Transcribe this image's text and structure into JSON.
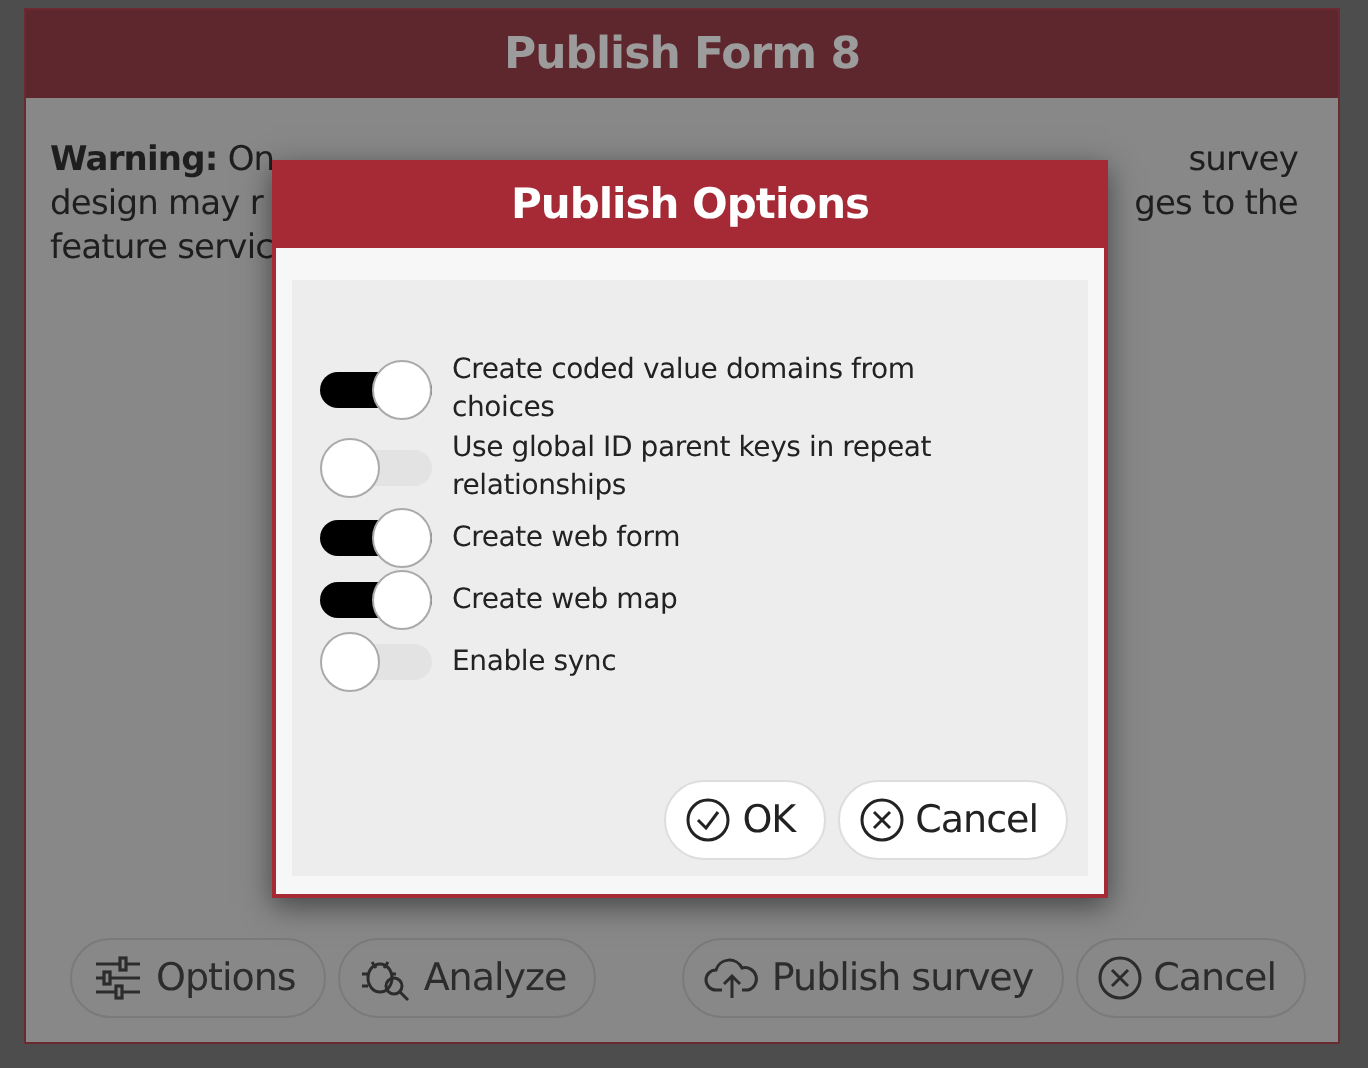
{
  "window": {
    "title": "Publish Form 8"
  },
  "warning": {
    "lines": [
      {
        "left": "**Warning:** On",
        "right": "survey"
      },
      {
        "left": "design may r",
        "right": "ges to the"
      },
      {
        "left": "feature servic"
      }
    ]
  },
  "footer_buttons": [
    {
      "label": "Options",
      "kind": "options"
    },
    {
      "label": "Analyze",
      "kind": "analyze"
    },
    {
      "label": "Publish survey",
      "kind": "publish"
    },
    {
      "label": "Cancel",
      "kind": "cancel"
    }
  ],
  "dialog": {
    "title": "Publish Options",
    "options": [
      {
        "label": "Create coded value domains from choices",
        "on": true
      },
      {
        "label": "Use global ID parent keys in repeat relationships",
        "on": false
      },
      {
        "label": "Create web form",
        "on": true
      },
      {
        "label": "Create web map",
        "on": true
      },
      {
        "label": "Enable sync",
        "on": false
      }
    ],
    "buttons": [
      {
        "label": "OK",
        "kind": "ok"
      },
      {
        "label": "Cancel",
        "kind": "cancel"
      }
    ]
  }
}
